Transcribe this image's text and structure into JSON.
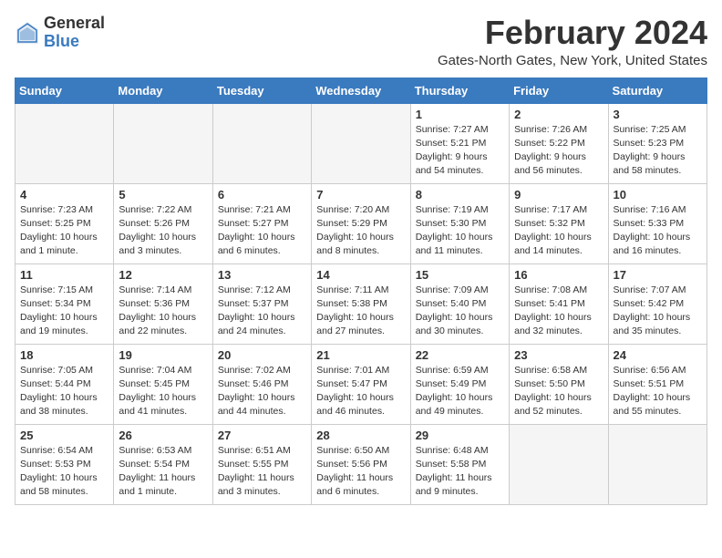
{
  "header": {
    "logo_general": "General",
    "logo_blue": "Blue",
    "month_title": "February 2024",
    "location": "Gates-North Gates, New York, United States"
  },
  "columns": [
    "Sunday",
    "Monday",
    "Tuesday",
    "Wednesday",
    "Thursday",
    "Friday",
    "Saturday"
  ],
  "weeks": [
    [
      {
        "day": "",
        "info": ""
      },
      {
        "day": "",
        "info": ""
      },
      {
        "day": "",
        "info": ""
      },
      {
        "day": "",
        "info": ""
      },
      {
        "day": "1",
        "info": "Sunrise: 7:27 AM\nSunset: 5:21 PM\nDaylight: 9 hours\nand 54 minutes."
      },
      {
        "day": "2",
        "info": "Sunrise: 7:26 AM\nSunset: 5:22 PM\nDaylight: 9 hours\nand 56 minutes."
      },
      {
        "day": "3",
        "info": "Sunrise: 7:25 AM\nSunset: 5:23 PM\nDaylight: 9 hours\nand 58 minutes."
      }
    ],
    [
      {
        "day": "4",
        "info": "Sunrise: 7:23 AM\nSunset: 5:25 PM\nDaylight: 10 hours\nand 1 minute."
      },
      {
        "day": "5",
        "info": "Sunrise: 7:22 AM\nSunset: 5:26 PM\nDaylight: 10 hours\nand 3 minutes."
      },
      {
        "day": "6",
        "info": "Sunrise: 7:21 AM\nSunset: 5:27 PM\nDaylight: 10 hours\nand 6 minutes."
      },
      {
        "day": "7",
        "info": "Sunrise: 7:20 AM\nSunset: 5:29 PM\nDaylight: 10 hours\nand 8 minutes."
      },
      {
        "day": "8",
        "info": "Sunrise: 7:19 AM\nSunset: 5:30 PM\nDaylight: 10 hours\nand 11 minutes."
      },
      {
        "day": "9",
        "info": "Sunrise: 7:17 AM\nSunset: 5:32 PM\nDaylight: 10 hours\nand 14 minutes."
      },
      {
        "day": "10",
        "info": "Sunrise: 7:16 AM\nSunset: 5:33 PM\nDaylight: 10 hours\nand 16 minutes."
      }
    ],
    [
      {
        "day": "11",
        "info": "Sunrise: 7:15 AM\nSunset: 5:34 PM\nDaylight: 10 hours\nand 19 minutes."
      },
      {
        "day": "12",
        "info": "Sunrise: 7:14 AM\nSunset: 5:36 PM\nDaylight: 10 hours\nand 22 minutes."
      },
      {
        "day": "13",
        "info": "Sunrise: 7:12 AM\nSunset: 5:37 PM\nDaylight: 10 hours\nand 24 minutes."
      },
      {
        "day": "14",
        "info": "Sunrise: 7:11 AM\nSunset: 5:38 PM\nDaylight: 10 hours\nand 27 minutes."
      },
      {
        "day": "15",
        "info": "Sunrise: 7:09 AM\nSunset: 5:40 PM\nDaylight: 10 hours\nand 30 minutes."
      },
      {
        "day": "16",
        "info": "Sunrise: 7:08 AM\nSunset: 5:41 PM\nDaylight: 10 hours\nand 32 minutes."
      },
      {
        "day": "17",
        "info": "Sunrise: 7:07 AM\nSunset: 5:42 PM\nDaylight: 10 hours\nand 35 minutes."
      }
    ],
    [
      {
        "day": "18",
        "info": "Sunrise: 7:05 AM\nSunset: 5:44 PM\nDaylight: 10 hours\nand 38 minutes."
      },
      {
        "day": "19",
        "info": "Sunrise: 7:04 AM\nSunset: 5:45 PM\nDaylight: 10 hours\nand 41 minutes."
      },
      {
        "day": "20",
        "info": "Sunrise: 7:02 AM\nSunset: 5:46 PM\nDaylight: 10 hours\nand 44 minutes."
      },
      {
        "day": "21",
        "info": "Sunrise: 7:01 AM\nSunset: 5:47 PM\nDaylight: 10 hours\nand 46 minutes."
      },
      {
        "day": "22",
        "info": "Sunrise: 6:59 AM\nSunset: 5:49 PM\nDaylight: 10 hours\nand 49 minutes."
      },
      {
        "day": "23",
        "info": "Sunrise: 6:58 AM\nSunset: 5:50 PM\nDaylight: 10 hours\nand 52 minutes."
      },
      {
        "day": "24",
        "info": "Sunrise: 6:56 AM\nSunset: 5:51 PM\nDaylight: 10 hours\nand 55 minutes."
      }
    ],
    [
      {
        "day": "25",
        "info": "Sunrise: 6:54 AM\nSunset: 5:53 PM\nDaylight: 10 hours\nand 58 minutes."
      },
      {
        "day": "26",
        "info": "Sunrise: 6:53 AM\nSunset: 5:54 PM\nDaylight: 11 hours\nand 1 minute."
      },
      {
        "day": "27",
        "info": "Sunrise: 6:51 AM\nSunset: 5:55 PM\nDaylight: 11 hours\nand 3 minutes."
      },
      {
        "day": "28",
        "info": "Sunrise: 6:50 AM\nSunset: 5:56 PM\nDaylight: 11 hours\nand 6 minutes."
      },
      {
        "day": "29",
        "info": "Sunrise: 6:48 AM\nSunset: 5:58 PM\nDaylight: 11 hours\nand 9 minutes."
      },
      {
        "day": "",
        "info": ""
      },
      {
        "day": "",
        "info": ""
      }
    ]
  ]
}
